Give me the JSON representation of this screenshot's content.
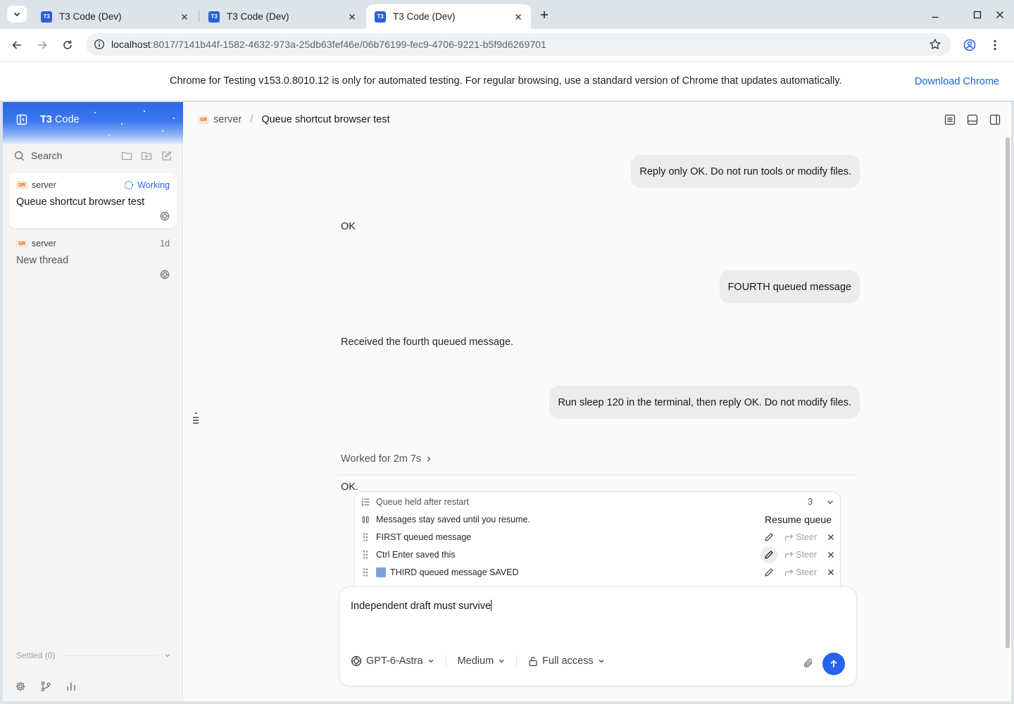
{
  "browser": {
    "tabs": [
      {
        "title": "T3 Code (Dev)",
        "favicon": "T3"
      },
      {
        "title": "T3 Code (Dev)",
        "favicon": "T3"
      },
      {
        "title": "T3 Code (Dev)",
        "favicon": "T3"
      }
    ],
    "active_tab": 2,
    "url_host": "localhost",
    "url_path": ":8017/7141b44f-1582-4632-973a-25db63fef46e/06b76199-fec9-4706-9221-b5f9d6269701",
    "infobar_message": "Chrome for Testing v153.0.8010.12 is only for automated testing. For regular browsing, use a standard version of Chrome that updates automatically.",
    "infobar_link": "Download Chrome"
  },
  "sidebar": {
    "brand_short": "T3",
    "brand_rest": "Code",
    "search_label": "Search",
    "threads": [
      {
        "project_badge": "SR",
        "project": "server",
        "status": "Working",
        "title": "Queue shortcut browser test",
        "active": true
      },
      {
        "project_badge": "SR",
        "project": "server",
        "when": "1d",
        "title": "New thread",
        "active": false
      }
    ],
    "settled_label": "Settled (0)"
  },
  "header": {
    "project_badge": "SR",
    "project": "server",
    "separator": "/",
    "thread_title": "Queue shortcut browser test"
  },
  "messages": {
    "user_1": "Reply only OK. Do not run tools or modify files.",
    "assistant_1": "OK",
    "user_2": "FOURTH queued message",
    "assistant_2": "Received the fourth queued message.",
    "user_3": "Run sleep 120 in the terminal, then reply OK. Do not modify files.",
    "worked_for": "Worked for 2m 7s",
    "assistant_3": "OK."
  },
  "queue": {
    "title": "Queue held after restart",
    "count": "3",
    "note": "Messages stay saved until you resume.",
    "resume_label": "Resume queue",
    "steer_label": "Steer",
    "items": [
      {
        "text": "FIRST queued message",
        "has_image": false
      },
      {
        "text": "Ctrl Enter saved this",
        "has_image": false
      },
      {
        "text": "THIRD queued message SAVED",
        "has_image": true
      }
    ]
  },
  "composer": {
    "draft": "Independent draft must survive",
    "model": "GPT-6-Astra",
    "effort": "Medium",
    "access": "Full access"
  },
  "colors": {
    "accent": "#2563eb",
    "working": "#2563eb",
    "project_badge_bg": "#fde7d3",
    "project_badge_fg": "#d4651b"
  }
}
